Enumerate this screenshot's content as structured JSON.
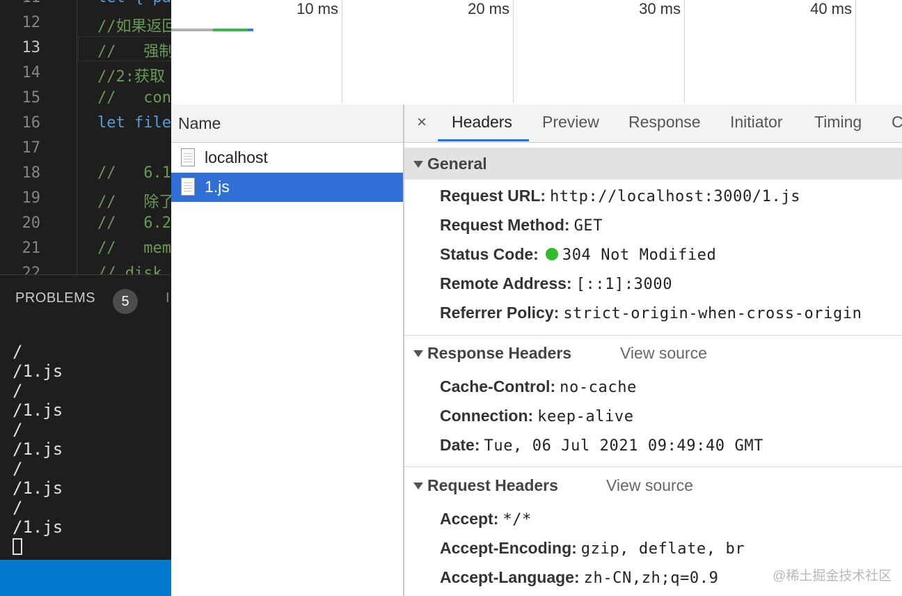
{
  "editor": {
    "line_numbers": [
      "11",
      "12",
      "13",
      "14",
      "15",
      "16",
      "17",
      "18",
      "19",
      "20",
      "21",
      "22"
    ],
    "active_line": "13",
    "lines": [
      {
        "text": "let { pa",
        "cls": "kw"
      },
      {
        "text": "//如果返回",
        "cls": "cm"
      },
      {
        "text": "//   强制",
        "cls": "cm"
      },
      {
        "text": "//2:获取",
        "cls": "cm"
      },
      {
        "text": "//   con",
        "cls": "cm"
      },
      {
        "text": "let file",
        "cls": "kw"
      },
      {
        "text": "",
        "cls": "cm"
      },
      {
        "text": "//   6.1",
        "cls": "cm"
      },
      {
        "text": "//   除了",
        "cls": "cm"
      },
      {
        "text": "//   6.2",
        "cls": "cm"
      },
      {
        "text": "//   mem",
        "cls": "cm"
      },
      {
        "text": "// disk",
        "cls": "cm"
      }
    ]
  },
  "panel": {
    "problems_label": "PROBLEMS",
    "problems_count": "5",
    "terminal_lines": [
      "/",
      "/1.js",
      "/",
      "/1.js",
      "/",
      "/1.js",
      "/",
      "/1.js",
      "/",
      "/1.js"
    ]
  },
  "waterfall": {
    "ticks": [
      "10 ms",
      "20 ms",
      "30 ms",
      "40 ms"
    ]
  },
  "requests": {
    "column_header": "Name",
    "items": [
      "localhost",
      "1.js"
    ],
    "selected_index": 1
  },
  "detail": {
    "close_label": "×",
    "tabs": [
      "Headers",
      "Preview",
      "Response",
      "Initiator",
      "Timing",
      "C"
    ],
    "active_tab": "Headers",
    "general": {
      "title": "General",
      "rows": [
        {
          "key": "Request URL:",
          "value": "http://localhost:3000/1.js"
        },
        {
          "key": "Request Method:",
          "value": "GET"
        },
        {
          "key": "Status Code:",
          "value": "304 Not Modified",
          "status_color": "#2dbd2d"
        },
        {
          "key": "Remote Address:",
          "value": "[::1]:3000"
        },
        {
          "key": "Referrer Policy:",
          "value": "strict-origin-when-cross-origin"
        }
      ]
    },
    "response_headers": {
      "title": "Response Headers",
      "view_source": "View source",
      "rows": [
        {
          "key": "Cache-Control:",
          "value": "no-cache"
        },
        {
          "key": "Connection:",
          "value": "keep-alive"
        },
        {
          "key": "Date:",
          "value": "Tue, 06 Jul 2021 09:49:40 GMT"
        }
      ]
    },
    "request_headers": {
      "title": "Request Headers",
      "view_source": "View source",
      "rows": [
        {
          "key": "Accept:",
          "value": "*/*"
        },
        {
          "key": "Accept-Encoding:",
          "value": "gzip, deflate, br"
        },
        {
          "key": "Accept-Language:",
          "value": "zh-CN,zh;q=0.9"
        }
      ]
    }
  },
  "watermark": "@稀土掘金技术社区",
  "colors": {
    "selection": "#2f6fd6",
    "tab_accent": "#1a73e8",
    "vscode_status": "#007acc"
  }
}
